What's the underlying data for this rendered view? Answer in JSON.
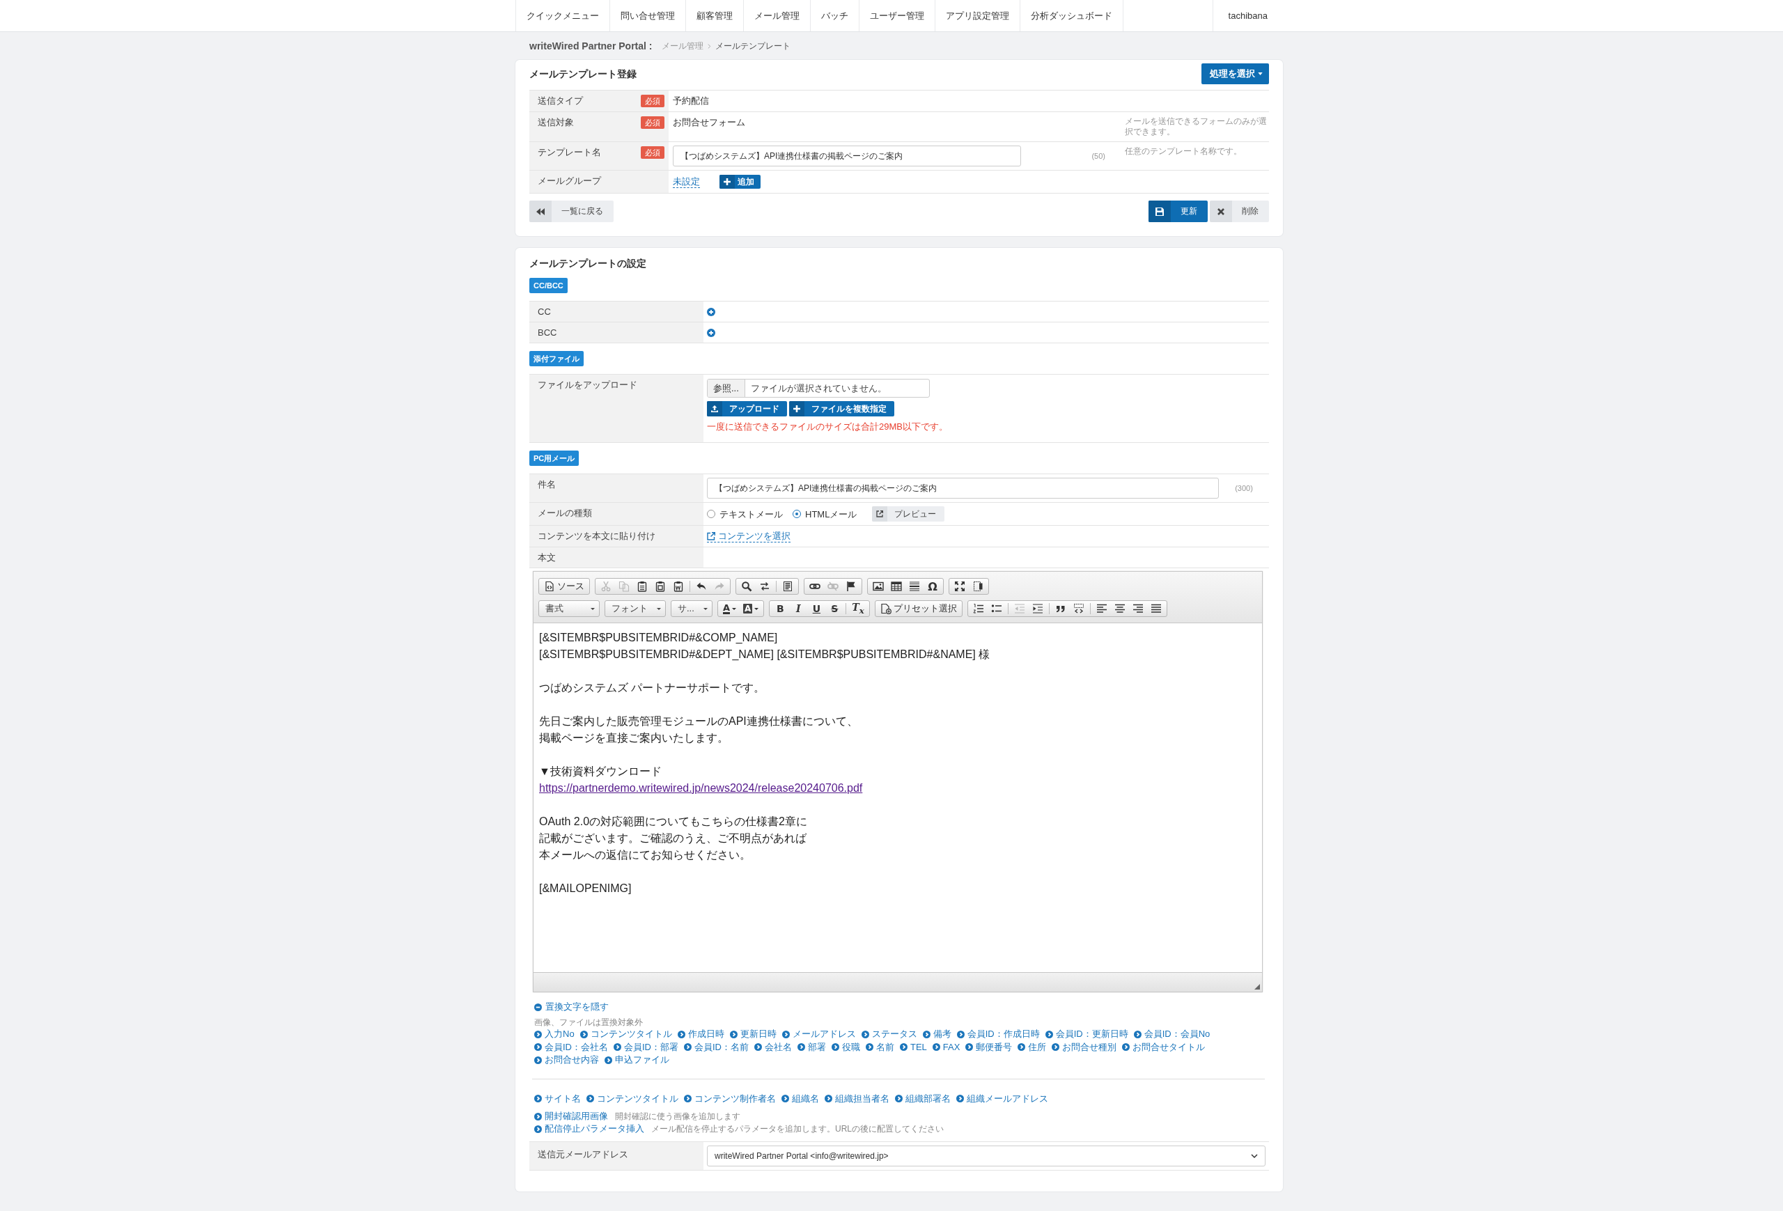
{
  "nav": {
    "items": [
      "クイックメニュー",
      "問い合せ管理",
      "顧客管理",
      "メール管理",
      "バッチ",
      "ユーザー管理",
      "アプリ設定管理",
      "分析ダッシュボード"
    ],
    "user": "tachibana"
  },
  "breadcrumb": {
    "site": "writeWired Partner Portal :",
    "items": [
      "メール管理",
      "メールテンプレート"
    ]
  },
  "register": {
    "title": "メールテンプレート登録",
    "action_button": "処理を選択",
    "rows": [
      {
        "kind": "text",
        "label": "送信タイプ",
        "required": "必須",
        "value": "予約配信"
      },
      {
        "kind": "text",
        "label": "送信対象",
        "required": "必須",
        "value": "お問合せフォーム",
        "note": "メールを送信できるフォームのみが選択できます。"
      },
      {
        "kind": "input",
        "label": "テンプレート名",
        "required": "必須",
        "value": "【つばめシステムズ】API連携仕様書の掲載ページのご案内",
        "count": "(50)",
        "note": "任意のテンプレート名称です。"
      },
      {
        "kind": "group",
        "label": "メールグループ",
        "value": "未設定",
        "button": "追加"
      }
    ],
    "back_button": "一覧に戻る",
    "save_button": "更新",
    "delete_button": "削除"
  },
  "settings": {
    "title": "メールテンプレートの設定",
    "sections": [
      {
        "badge": "CC/BCC",
        "rows": [
          {
            "kind": "add",
            "label": "CC"
          },
          {
            "kind": "add",
            "label": "BCC"
          }
        ]
      },
      {
        "badge": "添付ファイル",
        "rows": [
          {
            "kind": "upload",
            "label": "ファイルをアップロード",
            "browse_button": "参照...",
            "file_status": "ファイルが選択されていません。",
            "upload_button": "アップロード",
            "multi_button": "ファイルを複数指定",
            "warning": "一度に送信できるファイルのサイズは合計29MB以下です。"
          }
        ]
      },
      {
        "badge": "PC用メール",
        "rows": [
          {
            "kind": "input",
            "label": "件名",
            "value": "【つばめシステムズ】API連携仕様書の掲載ページのご案内",
            "count": "(300)"
          },
          {
            "kind": "radio",
            "label": "メールの種類",
            "options": [
              {
                "label": "テキストメール",
                "selected": false
              },
              {
                "label": "HTMLメール",
                "selected": true
              }
            ],
            "button": "プレビュー"
          },
          {
            "kind": "link",
            "label": "コンテンツを本文に貼り付け",
            "link": "コンテンツを選択"
          },
          {
            "kind": "empty",
            "label": "本文"
          }
        ]
      }
    ],
    "editor": {
      "toolbar": [
        [
          {
            "kind": "buttons",
            "sections": [
              [
                {
                  "kind": "source",
                  "label": "ソース",
                  "disabled": false
                }
              ]
            ]
          },
          {
            "kind": "buttons",
            "sections": [
              [
                {
                  "kind": "cut",
                  "disabled": true
                },
                {
                  "kind": "copy",
                  "disabled": true
                },
                {
                  "kind": "paste",
                  "disabled": false
                },
                {
                  "kind": "paste-text",
                  "disabled": false
                },
                {
                  "kind": "paste-word",
                  "disabled": false
                }
              ],
              [
                {
                  "kind": "undo",
                  "disabled": false
                },
                {
                  "kind": "redo",
                  "disabled": true
                }
              ]
            ]
          },
          {
            "kind": "buttons",
            "sections": [
              [
                {
                  "kind": "find",
                  "disabled": false
                },
                {
                  "kind": "replace",
                  "disabled": false
                }
              ],
              [
                {
                  "kind": "select-all",
                  "disabled": false
                }
              ]
            ]
          },
          {
            "kind": "buttons",
            "sections": [
              [
                {
                  "kind": "link",
                  "disabled": false
                },
                {
                  "kind": "unlink",
                  "disabled": true
                },
                {
                  "kind": "anchor",
                  "disabled": false
                }
              ]
            ]
          },
          {
            "kind": "buttons",
            "sections": [
              [
                {
                  "kind": "image",
                  "disabled": false
                },
                {
                  "kind": "table",
                  "disabled": false
                },
                {
                  "kind": "hr",
                  "disabled": false
                },
                {
                  "kind": "special",
                  "label": "Ω",
                  "disabled": false
                }
              ]
            ]
          },
          {
            "kind": "buttons",
            "sections": [
              [
                {
                  "kind": "maximize",
                  "disabled": false
                },
                {
                  "kind": "show-blocks",
                  "disabled": false
                }
              ]
            ]
          }
        ],
        [
          {
            "kind": "dropdown",
            "label": "書式"
          },
          {
            "kind": "dropdown",
            "label": "フォント"
          },
          {
            "kind": "dropdown",
            "label": "サ..."
          },
          {
            "kind": "buttons",
            "sections": [
              [
                {
                  "kind": "text-color",
                  "label": "A",
                  "disabled": false
                },
                {
                  "kind": "bg-color",
                  "label": "A",
                  "disabled": false
                }
              ]
            ]
          },
          {
            "kind": "buttons",
            "sections": [
              [
                {
                  "kind": "bold",
                  "label": "B",
                  "disabled": false
                },
                {
                  "kind": "italic",
                  "label": "I",
                  "disabled": false
                },
                {
                  "kind": "underline",
                  "label": "U",
                  "disabled": false
                },
                {
                  "kind": "strike",
                  "label": "S",
                  "disabled": false
                }
              ],
              [
                {
                  "kind": "remove-format",
                  "label": "T$_{x}$",
                  "disabled": false
                }
              ]
            ]
          },
          {
            "kind": "buttons",
            "sections": [
              [
                {
                  "kind": "preset",
                  "label": "プリセット選択",
                  "disabled": false
                }
              ]
            ]
          },
          {
            "kind": "buttons",
            "sections": [
              [
                {
                  "kind": "numbered",
                  "disabled": false
                },
                {
                  "kind": "bulleted",
                  "disabled": false
                }
              ],
              [
                {
                  "kind": "outdent",
                  "disabled": true
                },
                {
                  "kind": "indent",
                  "disabled": false
                }
              ],
              [
                {
                  "kind": "blockquote",
                  "disabled": false
                },
                {
                  "kind": "div",
                  "disabled": false
                }
              ],
              [
                {
                  "kind": "align-left",
                  "disabled": false
                },
                {
                  "kind": "align-center",
                  "disabled": false
                },
                {
                  "kind": "align-right",
                  "disabled": false
                },
                {
                  "kind": "justify",
                  "disabled": false
                }
              ]
            ]
          }
        ]
      ],
      "paragraphs": [
        {
          "lines": [
            {
              "kind": "text",
              "text": "[&SITEMBR$PUBSITEMBRID#&COMP_NAME]"
            },
            {
              "kind": "text",
              "text": "[&SITEMBR$PUBSITEMBRID#&DEPT_NAME] [&SITEMBR$PUBSITEMBRID#&NAME] 様"
            }
          ]
        },
        {
          "lines": [
            {
              "kind": "text",
              "text": "つばめシステムズ パートナーサポートです。"
            }
          ]
        },
        {
          "lines": [
            {
              "kind": "text",
              "text": "先日ご案内した販売管理モジュールのAPI連携仕様書について、"
            },
            {
              "kind": "text",
              "text": "掲載ページを直接ご案内いたします。"
            }
          ]
        },
        {
          "lines": [
            {
              "kind": "text",
              "text": "▼技術資料ダウンロード"
            },
            {
              "kind": "link",
              "text": "https://partnerdemo.writewired.jp/news2024/release20240706.pdf"
            }
          ]
        },
        {
          "lines": [
            {
              "kind": "text",
              "text": "OAuth 2.0の対応範囲についてもこちらの仕様書2章に"
            },
            {
              "kind": "text",
              "text": "記載がございます。ご確認のうえ、ご不明点があれば"
            },
            {
              "kind": "text",
              "text": "本メールへの返信にてお知らせください。"
            }
          ]
        },
        {
          "lines": [
            {
              "kind": "text",
              "text": "[&MAILOPENIMG]"
            }
          ]
        }
      ]
    },
    "placeholders": {
      "toggle": "置換文字を隠す",
      "note": "画像、ファイルは置換対象外",
      "tag_rows": [
        [
          "入力No",
          "コンテンツタイトル",
          "作成日時",
          "更新日時",
          "メールアドレス",
          "ステータス",
          "備考",
          "会員ID：作成日時",
          "会員ID：更新日時",
          "会員ID：会員No"
        ],
        [
          "会員ID：会社名",
          "会員ID：部署",
          "会員ID：名前",
          "会社名",
          "部署",
          "役職",
          "名前",
          "TEL",
          "FAX",
          "郵便番号",
          "住所",
          "お問合せ種別",
          "お問合せタイトル"
        ],
        [
          "お問合せ内容",
          "申込ファイル"
        ]
      ],
      "site_tags": [
        "サイト名",
        "コンテンツタイトル",
        "コンテンツ制作者名",
        "組織名",
        "組織担当者名",
        "組織部署名",
        "組織メールアドレス"
      ],
      "special_tags": [
        {
          "label": "開封確認用画像",
          "description": "開封確認に使う画像を追加します"
        },
        {
          "label": "配信停止パラメータ挿入",
          "description": "メール配信を停止するパラメータを追加します。URLの後に配置してください"
        }
      ]
    },
    "sender": {
      "label": "送信元メールアドレス",
      "value": "writeWired Partner Portal <info@writewired.jp>"
    }
  }
}
